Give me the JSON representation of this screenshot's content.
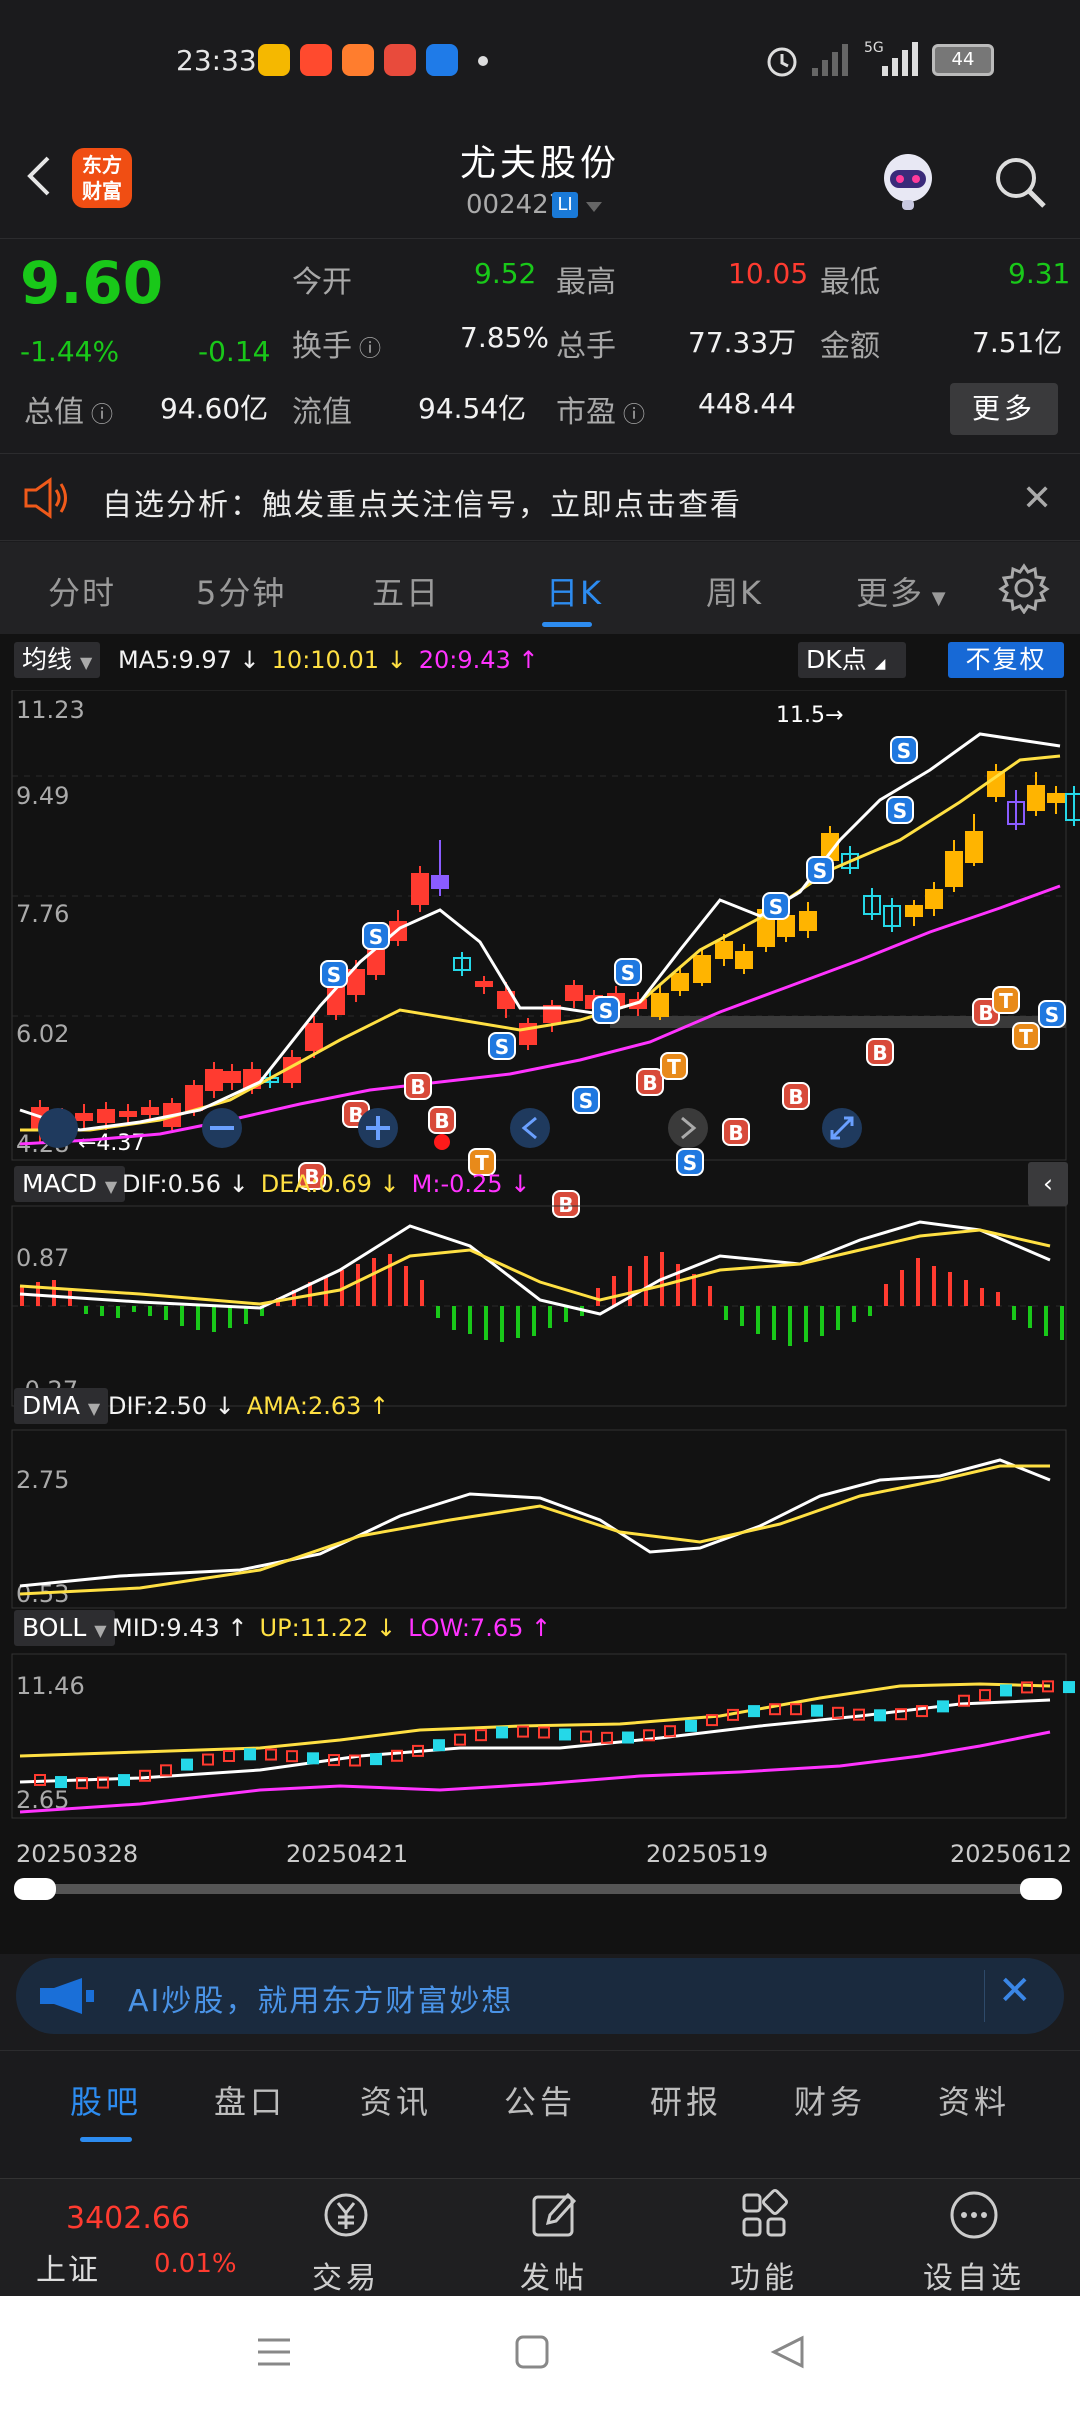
{
  "status_bar": {
    "time": "23:33",
    "battery": "44",
    "network": "5G"
  },
  "header": {
    "name": "尤夫股份",
    "code": "002427",
    "tag": "LI",
    "logo_line1": "东方",
    "logo_line2": "财富"
  },
  "quote": {
    "price": "9.60",
    "change_pct": "-1.44%",
    "change": "-0.14",
    "open_label": "今开",
    "open": "9.52",
    "high_label": "最高",
    "high": "10.05",
    "low_label": "最低",
    "low": "9.31",
    "turnover_label": "换手",
    "turnover": "7.85%",
    "volume_label": "总手",
    "volume": "77.33万",
    "amount_label": "金额",
    "amount": "7.51亿",
    "mktcap_label": "总值",
    "mktcap": "94.60亿",
    "float_label": "流值",
    "float_cap": "94.54亿",
    "pe_label": "市盈",
    "pe": "448.44",
    "more_label": "更多"
  },
  "signal_banner": {
    "text": "自选分析：触发重点关注信号，立即点击查看"
  },
  "period_tabs": [
    "分时",
    "5分钟",
    "五日",
    "日K",
    "周K",
    "更多"
  ],
  "kline": {
    "ma_chip": "均线",
    "ma5": "MA5:9.97 ↓",
    "ma10": "10:10.01 ↓",
    "ma20": "20:9.43 ↑",
    "dk_chip": "DK点",
    "adjust_chip": "不复权",
    "y_top": "11.23",
    "y_2": "9.49",
    "y_3": "7.76",
    "y_4": "6.02",
    "y_bottom": "4.28",
    "min_label": "←4.37",
    "max_label": "11.5→"
  },
  "macd": {
    "chip": "MACD",
    "dif": "DIF:0.56 ↓",
    "dea": "DEA:0.69 ↓",
    "m": "M:-0.25 ↓",
    "y_top": "0.87",
    "y_bottom": "-0.27"
  },
  "dma": {
    "chip": "DMA",
    "dif": "DIF:2.50 ↓",
    "ama": "AMA:2.63 ↑",
    "y_top": "2.75",
    "y_bottom": "0.53"
  },
  "boll": {
    "chip": "BOLL",
    "mid": "MID:9.43 ↑",
    "up": "UP:11.22 ↓",
    "low": "LOW:7.65 ↑",
    "y_top": "11.46",
    "y_bottom": "2.65"
  },
  "dates": [
    "20250328",
    "20250421",
    "20250519",
    "20250612"
  ],
  "ai_banner": {
    "text": "AI炒股，就用东方财富妙想"
  },
  "content_tabs": [
    "股吧",
    "盘口",
    "资讯",
    "公告",
    "研报",
    "财务",
    "资料"
  ],
  "bottom_nav": {
    "index_value": "3402.66",
    "index_name": "上证",
    "index_change": "0.01%",
    "items": [
      "交易",
      "发帖",
      "功能",
      "设自选"
    ]
  },
  "colors": {
    "up": "#ff3b30",
    "down": "#19c819",
    "accent": "#2d8cf0",
    "ma5": "#ffffff",
    "ma10": "#ffe043",
    "ma20": "#ff33ff"
  }
}
